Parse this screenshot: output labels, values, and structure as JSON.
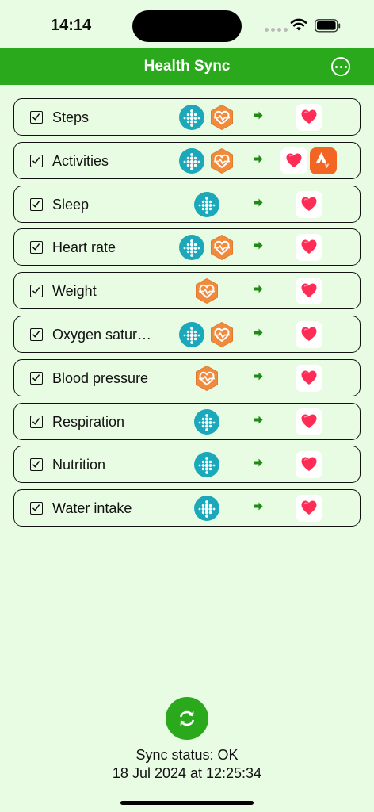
{
  "status_bar": {
    "time": "14:14"
  },
  "header": {
    "title": "Health Sync"
  },
  "rows": [
    {
      "label": "Steps",
      "checked": true
    },
    {
      "label": "Activities",
      "checked": true
    },
    {
      "label": "Sleep",
      "checked": true
    },
    {
      "label": "Heart rate",
      "checked": true
    },
    {
      "label": "Weight",
      "checked": true
    },
    {
      "label": "Oxygen satur…",
      "checked": true
    },
    {
      "label": "Blood pressure",
      "checked": true
    },
    {
      "label": "Respiration",
      "checked": true
    },
    {
      "label": "Nutrition",
      "checked": true
    },
    {
      "label": "Water intake",
      "checked": true
    }
  ],
  "sync": {
    "status": "Sync status: OK",
    "timestamp": "18 Jul 2024 at 12:25:34"
  },
  "icons": {
    "sources": [
      "fitbit-icon",
      "health-connect-icon"
    ],
    "destinations": [
      "apple-health-icon",
      "strava-icon"
    ],
    "menu": "ellipsis-circle-icon",
    "sync": "sync-arrows-icon"
  },
  "colors": {
    "background": "#e8fce3",
    "accent_green": "#2aa91c",
    "fitbit": "#1aa8ba",
    "health_connect": "#f08a3c",
    "strava": "#f26523",
    "heart": "#ff2d55"
  }
}
